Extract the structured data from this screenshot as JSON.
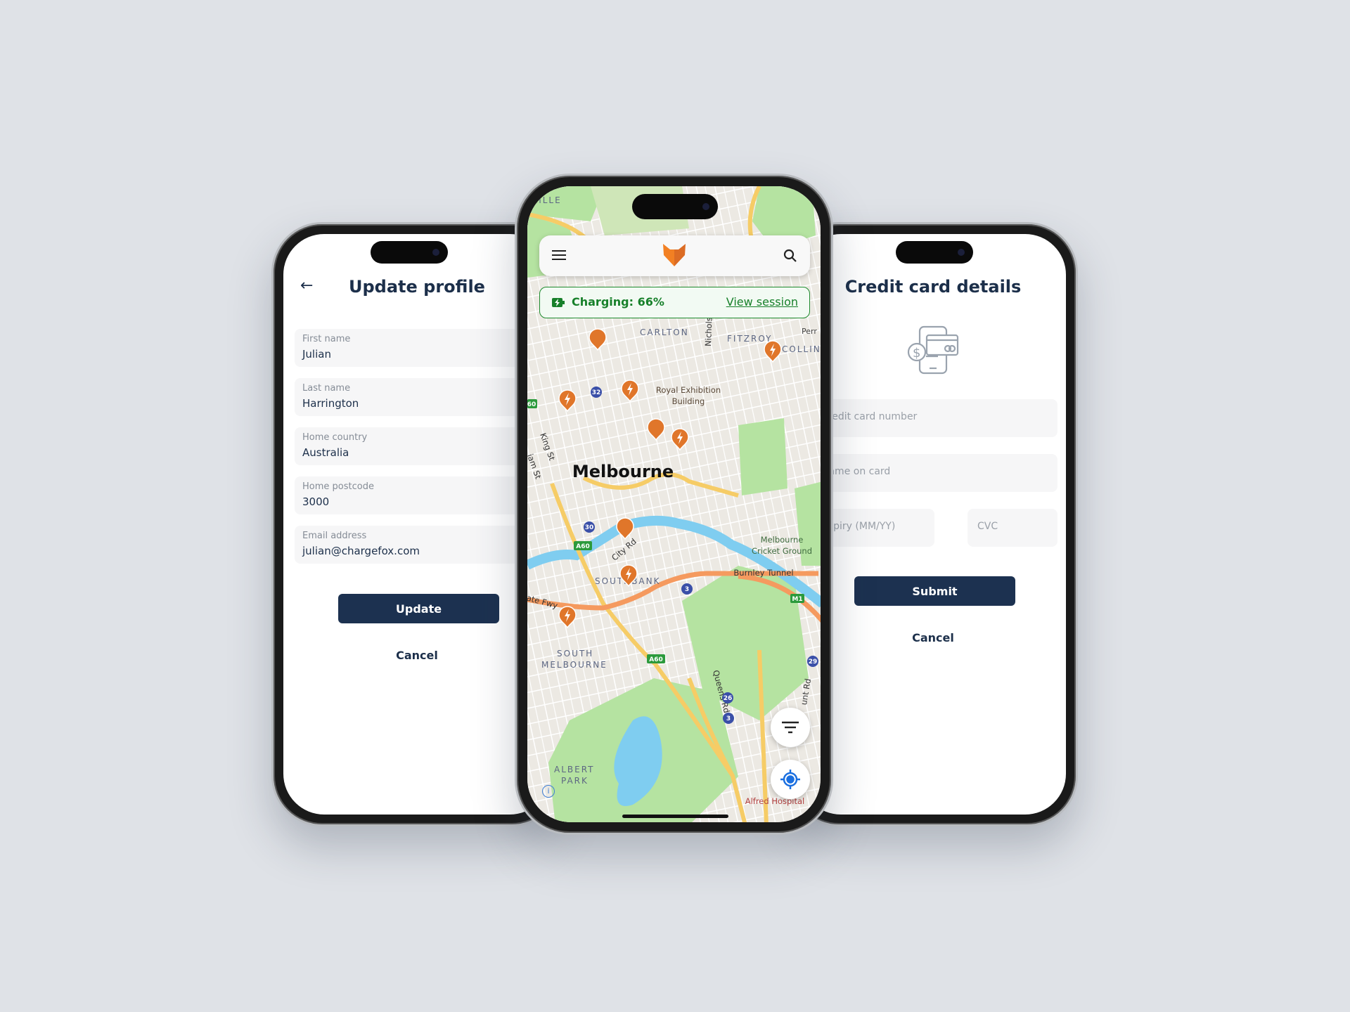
{
  "profile": {
    "title": "Update profile",
    "fields": [
      {
        "label": "First name",
        "value": "Julian"
      },
      {
        "label": "Last name",
        "value": "Harrington"
      },
      {
        "label": "Home country",
        "value": "Australia"
      },
      {
        "label": "Home postcode",
        "value": "3000"
      },
      {
        "label": "Email address",
        "value": "julian@chargefox.com"
      }
    ],
    "update_label": "Update",
    "cancel_label": "Cancel"
  },
  "map_screen": {
    "charging_text": "Charging: 66%",
    "charging_percent": 66,
    "view_session_label": "View session",
    "brand_color": "#f28023",
    "accent_green": "#17802a",
    "labels": {
      "ville": "VILLE",
      "carlton": "CARLTON",
      "fitzroy": "FITZROY",
      "collingwood": "COLLING",
      "perr": "Perr",
      "royal1": "Royal Exhibition",
      "royal2": "Building",
      "melbourne": "Melbourne",
      "southbank": "SOUTHBANK",
      "south1": "SOUTH",
      "south2": "MELBOURNE",
      "albert1": "ALBERT",
      "albert2": "PARK",
      "mcg1": "Melbourne",
      "mcg2": "Cricket Ground",
      "burnley": "Burnley Tunnel",
      "cityrd": "City Rd",
      "kingst": "King St",
      "nicholson": "Nicholson",
      "queensrd": "Queens Rd",
      "alfred": "Alfred Hospital",
      "fwy": "ate Fwy",
      "huntrd": "unt Rd",
      "williamst": "iam St"
    },
    "route_badges": [
      "32",
      "30",
      "3",
      "26",
      "3",
      "29"
    ],
    "green_badges": [
      "A60",
      "A60",
      "M1",
      "60"
    ]
  },
  "card": {
    "title": "Credit card details",
    "placeholders": {
      "number": "Credit card number",
      "name": "Name on card",
      "expiry": "Expiry (MM/YY)",
      "cvc": "CVC"
    },
    "submit_label": "Submit",
    "cancel_label": "Cancel"
  }
}
